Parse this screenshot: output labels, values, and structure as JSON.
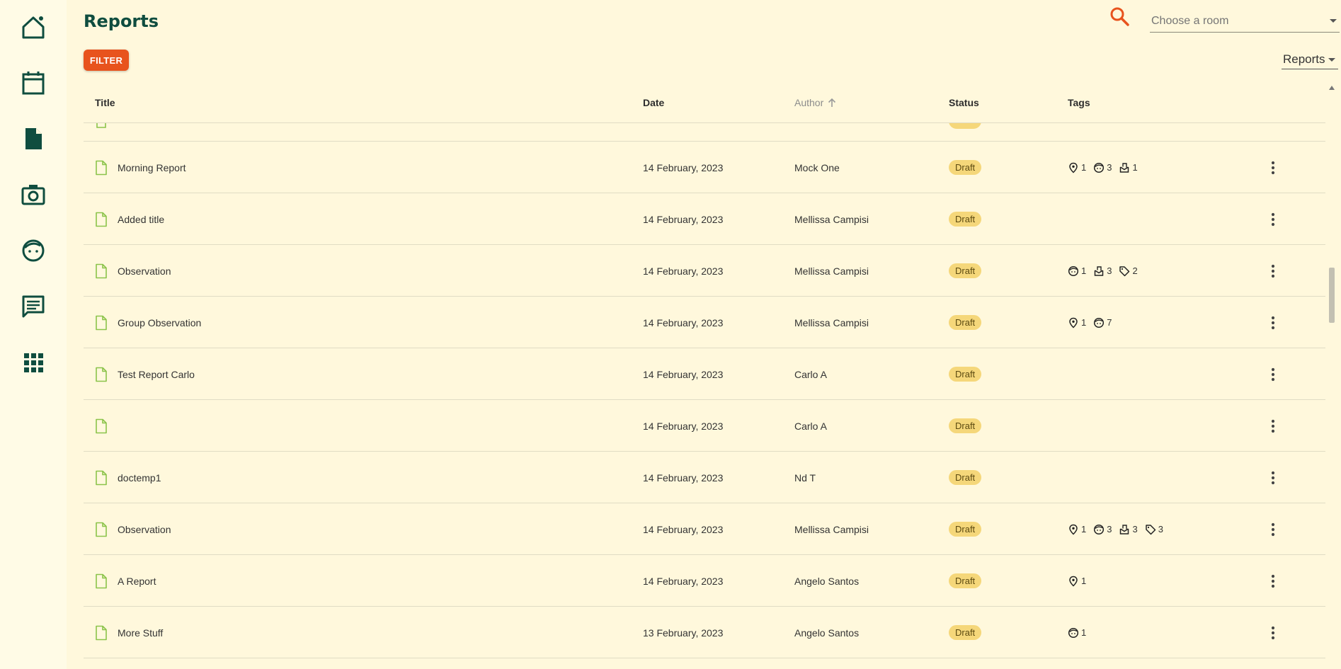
{
  "page": {
    "title": "Reports"
  },
  "toolbar": {
    "room_placeholder": "Choose a room",
    "filter_label": "FILTER",
    "view_selected": "Reports"
  },
  "table": {
    "columns": {
      "title": "Title",
      "date": "Date",
      "author": "Author",
      "status": "Status",
      "tags": "Tags"
    },
    "sort": {
      "column": "author",
      "direction": "asc"
    },
    "partial_row_status": "",
    "rows": [
      {
        "title": "Morning Report",
        "date": "14 February, 2023",
        "author": "Mock One",
        "status": "Draft",
        "tags": [
          {
            "icon": "location-icon",
            "count": "1"
          },
          {
            "icon": "child-icon",
            "count": "3"
          },
          {
            "icon": "learning-icon",
            "count": "1"
          }
        ]
      },
      {
        "title": "Added title",
        "date": "14 February, 2023",
        "author": "Mellissa Campisi",
        "status": "Draft",
        "tags": []
      },
      {
        "title": "Observation",
        "date": "14 February, 2023",
        "author": "Mellissa Campisi",
        "status": "Draft",
        "tags": [
          {
            "icon": "child-icon",
            "count": "1"
          },
          {
            "icon": "learning-icon",
            "count": "3"
          },
          {
            "icon": "tag-icon",
            "count": "2"
          }
        ]
      },
      {
        "title": "Group Observation",
        "date": "14 February, 2023",
        "author": "Mellissa Campisi",
        "status": "Draft",
        "tags": [
          {
            "icon": "location-icon",
            "count": "1"
          },
          {
            "icon": "child-icon",
            "count": "7"
          }
        ]
      },
      {
        "title": "Test Report Carlo",
        "date": "14 February, 2023",
        "author": "Carlo A",
        "status": "Draft",
        "tags": []
      },
      {
        "title": "",
        "date": "14 February, 2023",
        "author": "Carlo A",
        "status": "Draft",
        "tags": []
      },
      {
        "title": "doctemp1",
        "date": "14 February, 2023",
        "author": "Nd T",
        "status": "Draft",
        "tags": []
      },
      {
        "title": "Observation",
        "date": "14 February, 2023",
        "author": "Mellissa Campisi",
        "status": "Draft",
        "tags": [
          {
            "icon": "location-icon",
            "count": "1"
          },
          {
            "icon": "child-icon",
            "count": "3"
          },
          {
            "icon": "learning-icon",
            "count": "3"
          },
          {
            "icon": "tag-icon",
            "count": "3"
          }
        ]
      },
      {
        "title": "A Report",
        "date": "14 February, 2023",
        "author": "Angelo Santos",
        "status": "Draft",
        "tags": [
          {
            "icon": "location-icon",
            "count": "1"
          }
        ]
      },
      {
        "title": "More Stuff",
        "date": "13 February, 2023",
        "author": "Angelo Santos",
        "status": "Draft",
        "tags": [
          {
            "icon": "child-icon",
            "count": "1"
          }
        ]
      }
    ]
  },
  "sidebar": {
    "items": [
      {
        "icon": "home-icon"
      },
      {
        "icon": "calendar-icon"
      },
      {
        "icon": "document-icon"
      },
      {
        "icon": "camera-icon"
      },
      {
        "icon": "child-face-icon"
      },
      {
        "icon": "chat-icon"
      },
      {
        "icon": "apps-grid-icon"
      }
    ]
  },
  "colors": {
    "accent": "#e8531d",
    "brand_dark": "#0f4d3f",
    "badge_bg": "#f5d77a",
    "doc_icon": "#8bc34a",
    "background": "#fff8dc"
  }
}
